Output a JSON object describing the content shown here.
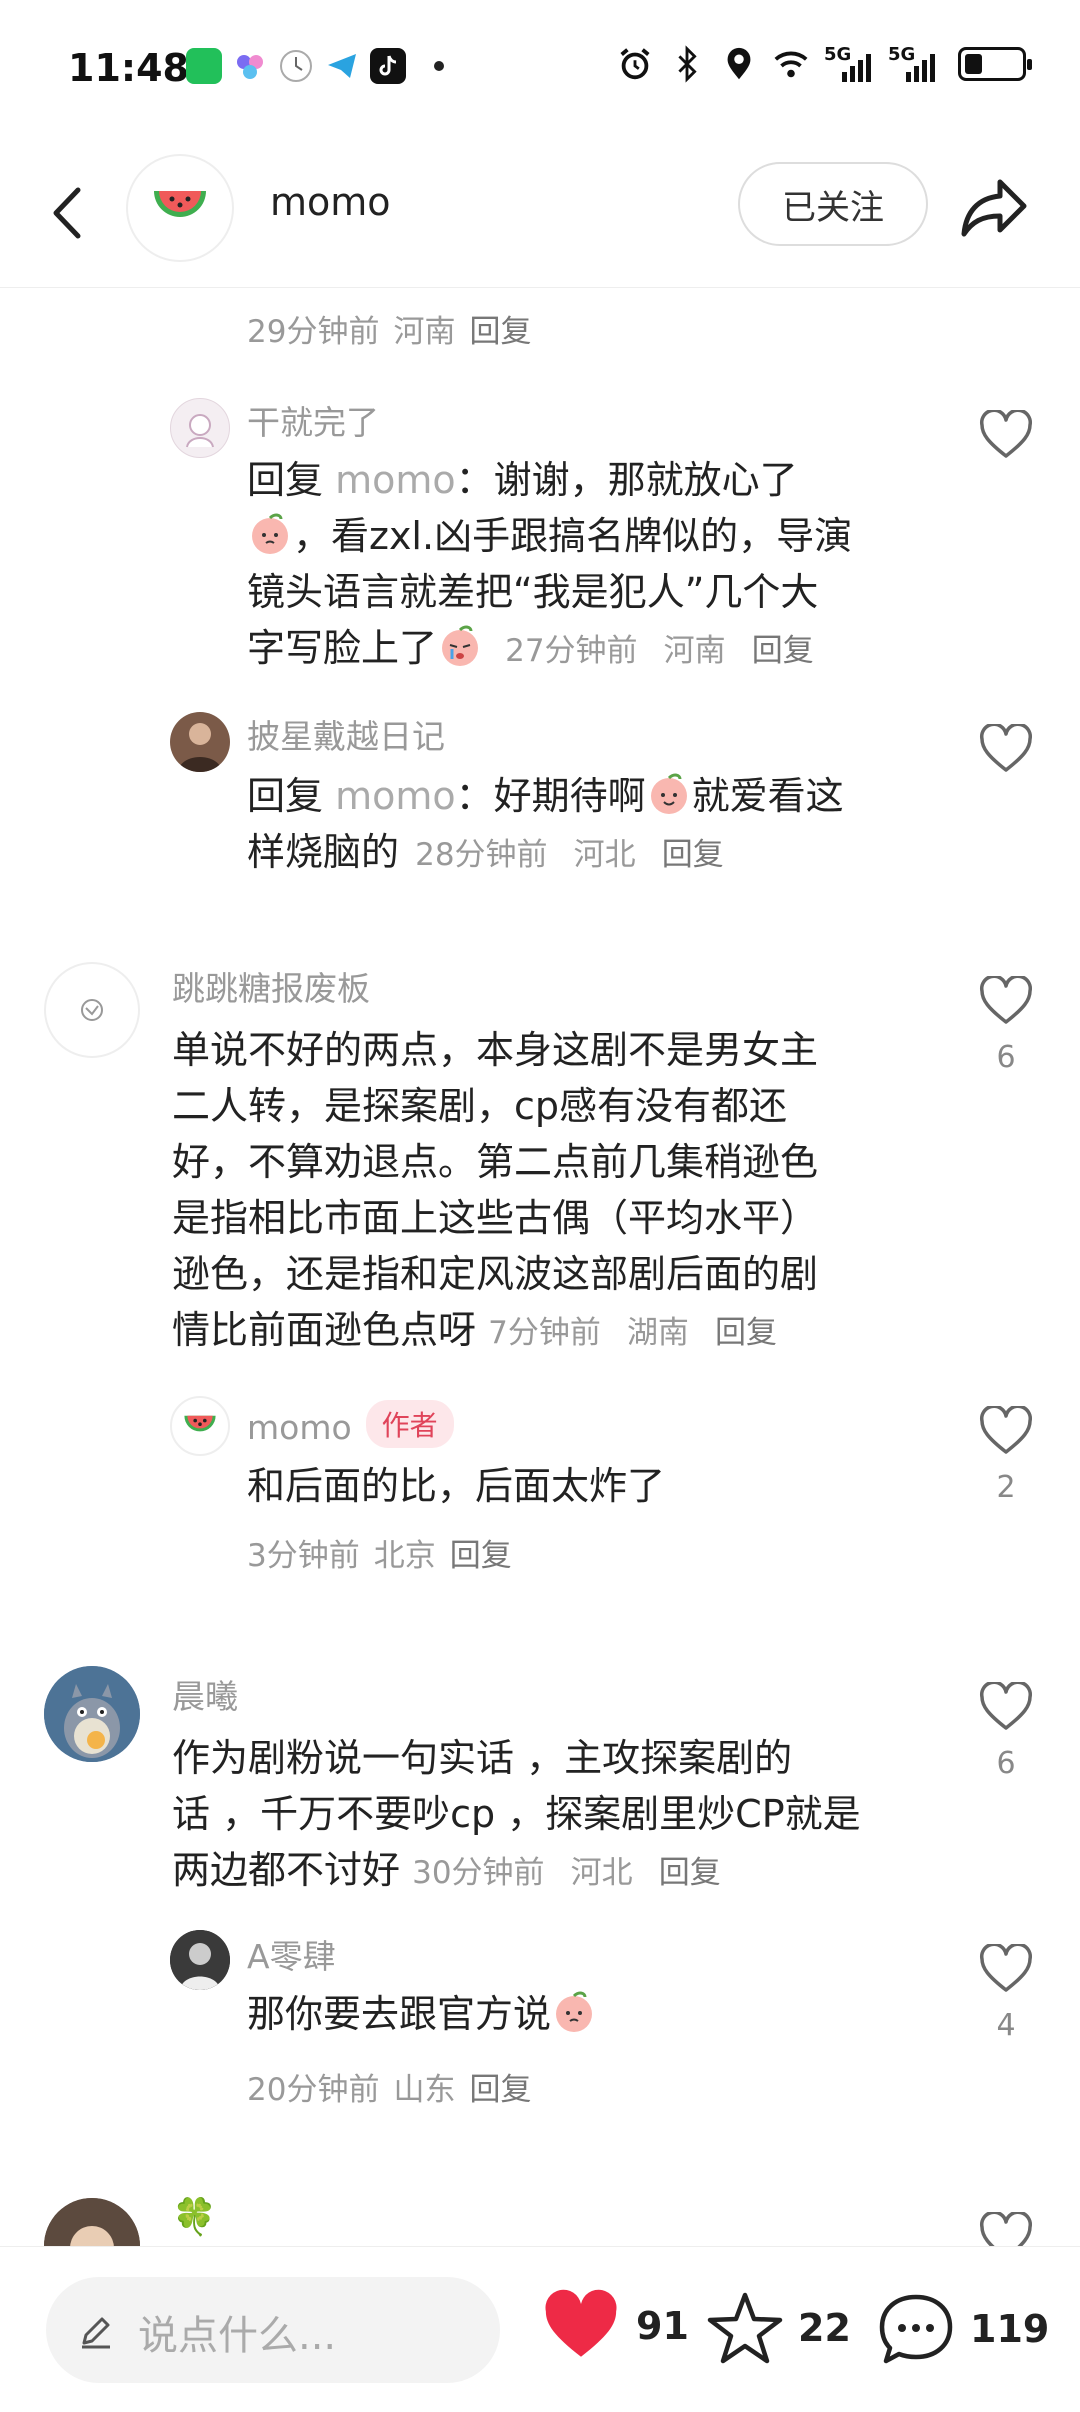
{
  "status": {
    "time": "11:48",
    "net1": "5G",
    "net2": "5G",
    "battery_percent": 30
  },
  "header": {
    "title": "momo",
    "follow_label": "已关注"
  },
  "comments": {
    "top_meta": {
      "time": "29分钟前",
      "loc": "河南",
      "reply": "回复"
    },
    "c1": {
      "name": "干就完了",
      "reply_prefix": "回复",
      "reply_to": "momo",
      "line1": "：谢谢，那就放心了",
      "line2": "，看zxl.凶手跟搞名牌似的，导演",
      "line3": "镜头语言就差把“我是犯人”几个大",
      "line4": "字写脸上了",
      "time": "27分钟前",
      "loc": "河南",
      "reply": "回复"
    },
    "c2": {
      "name": "披星戴越日记",
      "reply_prefix": "回复",
      "reply_to": "momo",
      "line1": "：好期待啊",
      "line1b": "就爱看这",
      "line2": "样烧脑的",
      "time": "28分钟前",
      "loc": "河北",
      "reply": "回复"
    },
    "c3": {
      "name": "跳跳糖报废板",
      "lines": [
        "单说不好的两点，本身这剧不是男女主",
        "二人转，是探案剧，cp感有没有都还",
        "好，不算劝退点。第二点前几集稍逊色",
        "是指相比市面上这些古偶（平均水平）",
        "逊色，还是指和定风波这部剧后面的剧",
        "情比前面逊色点呀"
      ],
      "time": "7分钟前",
      "loc": "湖南",
      "reply": "回复",
      "likes": "6"
    },
    "c4": {
      "name": "momo",
      "badge": "作者",
      "text": "和后面的比，后面太炸了",
      "time": "3分钟前",
      "loc": "北京",
      "reply": "回复",
      "likes": "2"
    },
    "c5": {
      "name": "晨曦",
      "lines": [
        "作为剧粉说一句实话 ，主攻探案剧的",
        "话 ，千万不要吵cp ，探案剧里炒CP就是",
        "两边都不讨好"
      ],
      "time": "30分钟前",
      "loc": "河北",
      "reply": "回复",
      "likes": "6"
    },
    "c6": {
      "name": "A零肆",
      "text": "那你要去跟官方说",
      "time": "20分钟前",
      "loc": "山东",
      "reply": "回复",
      "likes": "4"
    },
    "c7": {
      "name": "🍀"
    }
  },
  "bottom": {
    "placeholder": "说点什么...",
    "likes": "91",
    "stars": "22",
    "comments": "119",
    "like_color": "#ee2a46"
  }
}
